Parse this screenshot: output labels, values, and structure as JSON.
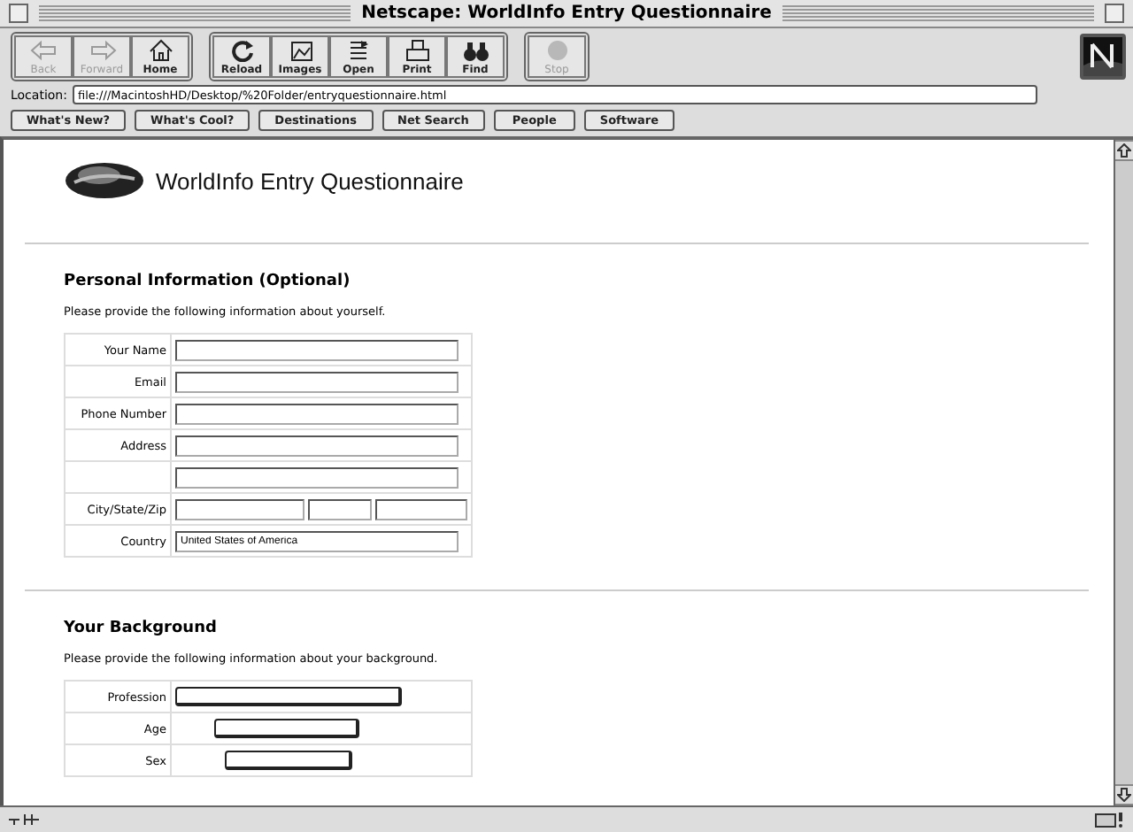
{
  "window": {
    "title": "Netscape: WorldInfo Entry Questionnaire"
  },
  "toolbar": [
    [
      {
        "label": "Back",
        "kind": "back",
        "disabled": true
      },
      {
        "label": "Forward",
        "kind": "forward",
        "disabled": true
      },
      {
        "label": "Home",
        "kind": "home",
        "disabled": false
      }
    ],
    [
      {
        "label": "Reload",
        "kind": "reload",
        "disabled": false
      },
      {
        "label": "Images",
        "kind": "images",
        "disabled": false
      },
      {
        "label": "Open",
        "kind": "open",
        "disabled": false
      },
      {
        "label": "Print",
        "kind": "print",
        "disabled": false
      },
      {
        "label": "Find",
        "kind": "find",
        "disabled": false
      }
    ],
    [
      {
        "label": "Stop",
        "kind": "stop",
        "disabled": true
      }
    ]
  ],
  "location": {
    "label": "Location:",
    "value": "file:///MacintoshHD/Desktop/%20Folder/entryquestionnaire.html"
  },
  "directory_buttons": [
    "What's New?",
    "What's Cool?",
    "Destinations",
    "Net Search",
    "People",
    "Software"
  ],
  "page": {
    "heading": "WorldInfo Entry Questionnaire",
    "sections": [
      {
        "title": "Personal Information (Optional)",
        "description": "Please provide the following information about yourself.",
        "rows": [
          {
            "label": "Your Name",
            "kind": "text"
          },
          {
            "label": "Email",
            "kind": "text"
          },
          {
            "label": "Phone Number",
            "kind": "text"
          },
          {
            "label": "Address",
            "kind": "text"
          },
          {
            "kind": "text"
          },
          {
            "label": "City/State/Zip",
            "kind": "split"
          },
          {
            "label": "Country",
            "kind": "text",
            "value": "United States of America"
          }
        ]
      },
      {
        "title": "Your Background",
        "description": "Please provide the following information about your background.",
        "rows": [
          {
            "label": "Profession",
            "kind": "wide"
          },
          {
            "label": "Age",
            "kind": "medium"
          },
          {
            "label": "Sex",
            "kind": "short"
          }
        ]
      }
    ]
  }
}
